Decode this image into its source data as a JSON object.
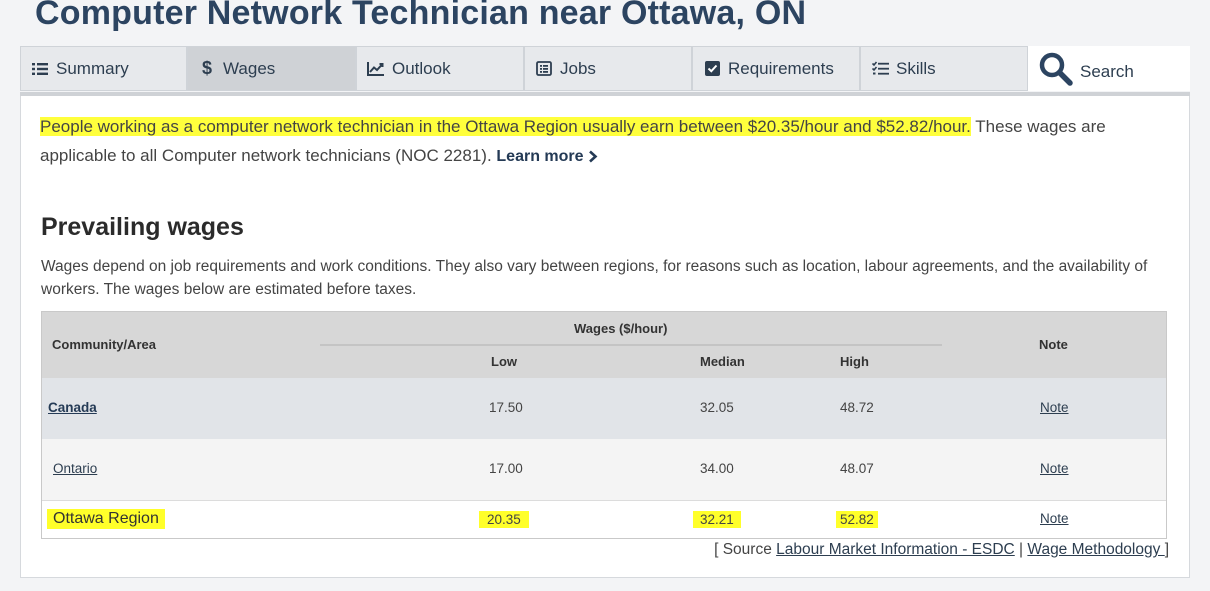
{
  "page": {
    "title": "Computer Network Technician near Ottawa, ON"
  },
  "tabs": [
    {
      "label": "Summary",
      "icon": "list-icon"
    },
    {
      "label": "Wages",
      "icon": "dollar-icon",
      "active": true
    },
    {
      "label": "Outlook",
      "icon": "line-chart-icon"
    },
    {
      "label": "Jobs",
      "icon": "document-list-icon"
    },
    {
      "label": "Requirements",
      "icon": "checkbox-icon"
    },
    {
      "label": "Skills",
      "icon": "checklist-icon"
    },
    {
      "label": "Search",
      "icon": "search-icon"
    }
  ],
  "intro": {
    "highlighted": "People working as a computer network technician in the Ottawa Region usually earn between $20.35/hour and $52.82/hour.",
    "rest": " These wages are applicable to all Computer network technicians (NOC 2281).",
    "learn_more": "Learn more"
  },
  "prevailing": {
    "title": "Prevailing wages",
    "description": "Wages depend on job requirements and work conditions. They also vary between regions, for reasons such as location, labour agreements, and the availability of workers. The wages below are estimated before taxes."
  },
  "table": {
    "headers": {
      "community": "Community/Area",
      "wages_group": "Wages ($/hour)",
      "low": "Low",
      "median": "Median",
      "high": "High",
      "note": "Note"
    },
    "rows": [
      {
        "area": "Canada",
        "low": "17.50",
        "median": "32.05",
        "high": "48.72",
        "note": "Note"
      },
      {
        "area": "Ontario ",
        "low": "17.00",
        "median": "34.00",
        "high": "48.07",
        "note": "Note"
      },
      {
        "area": "Ottawa Region",
        "low": "20.35",
        "median": "32.21",
        "high": "52.82",
        "note": "Note"
      }
    ]
  },
  "source": {
    "prefix": "[ Source ",
    "lmi_link": "Labour Market Information - ESDC",
    "separator": " | ",
    "method_link": "Wage Methodology ",
    "suffix": "]"
  },
  "colors": {
    "highlight": "#ffff3c",
    "title": "#2c4461",
    "active_tab": "#cfd2d6"
  }
}
